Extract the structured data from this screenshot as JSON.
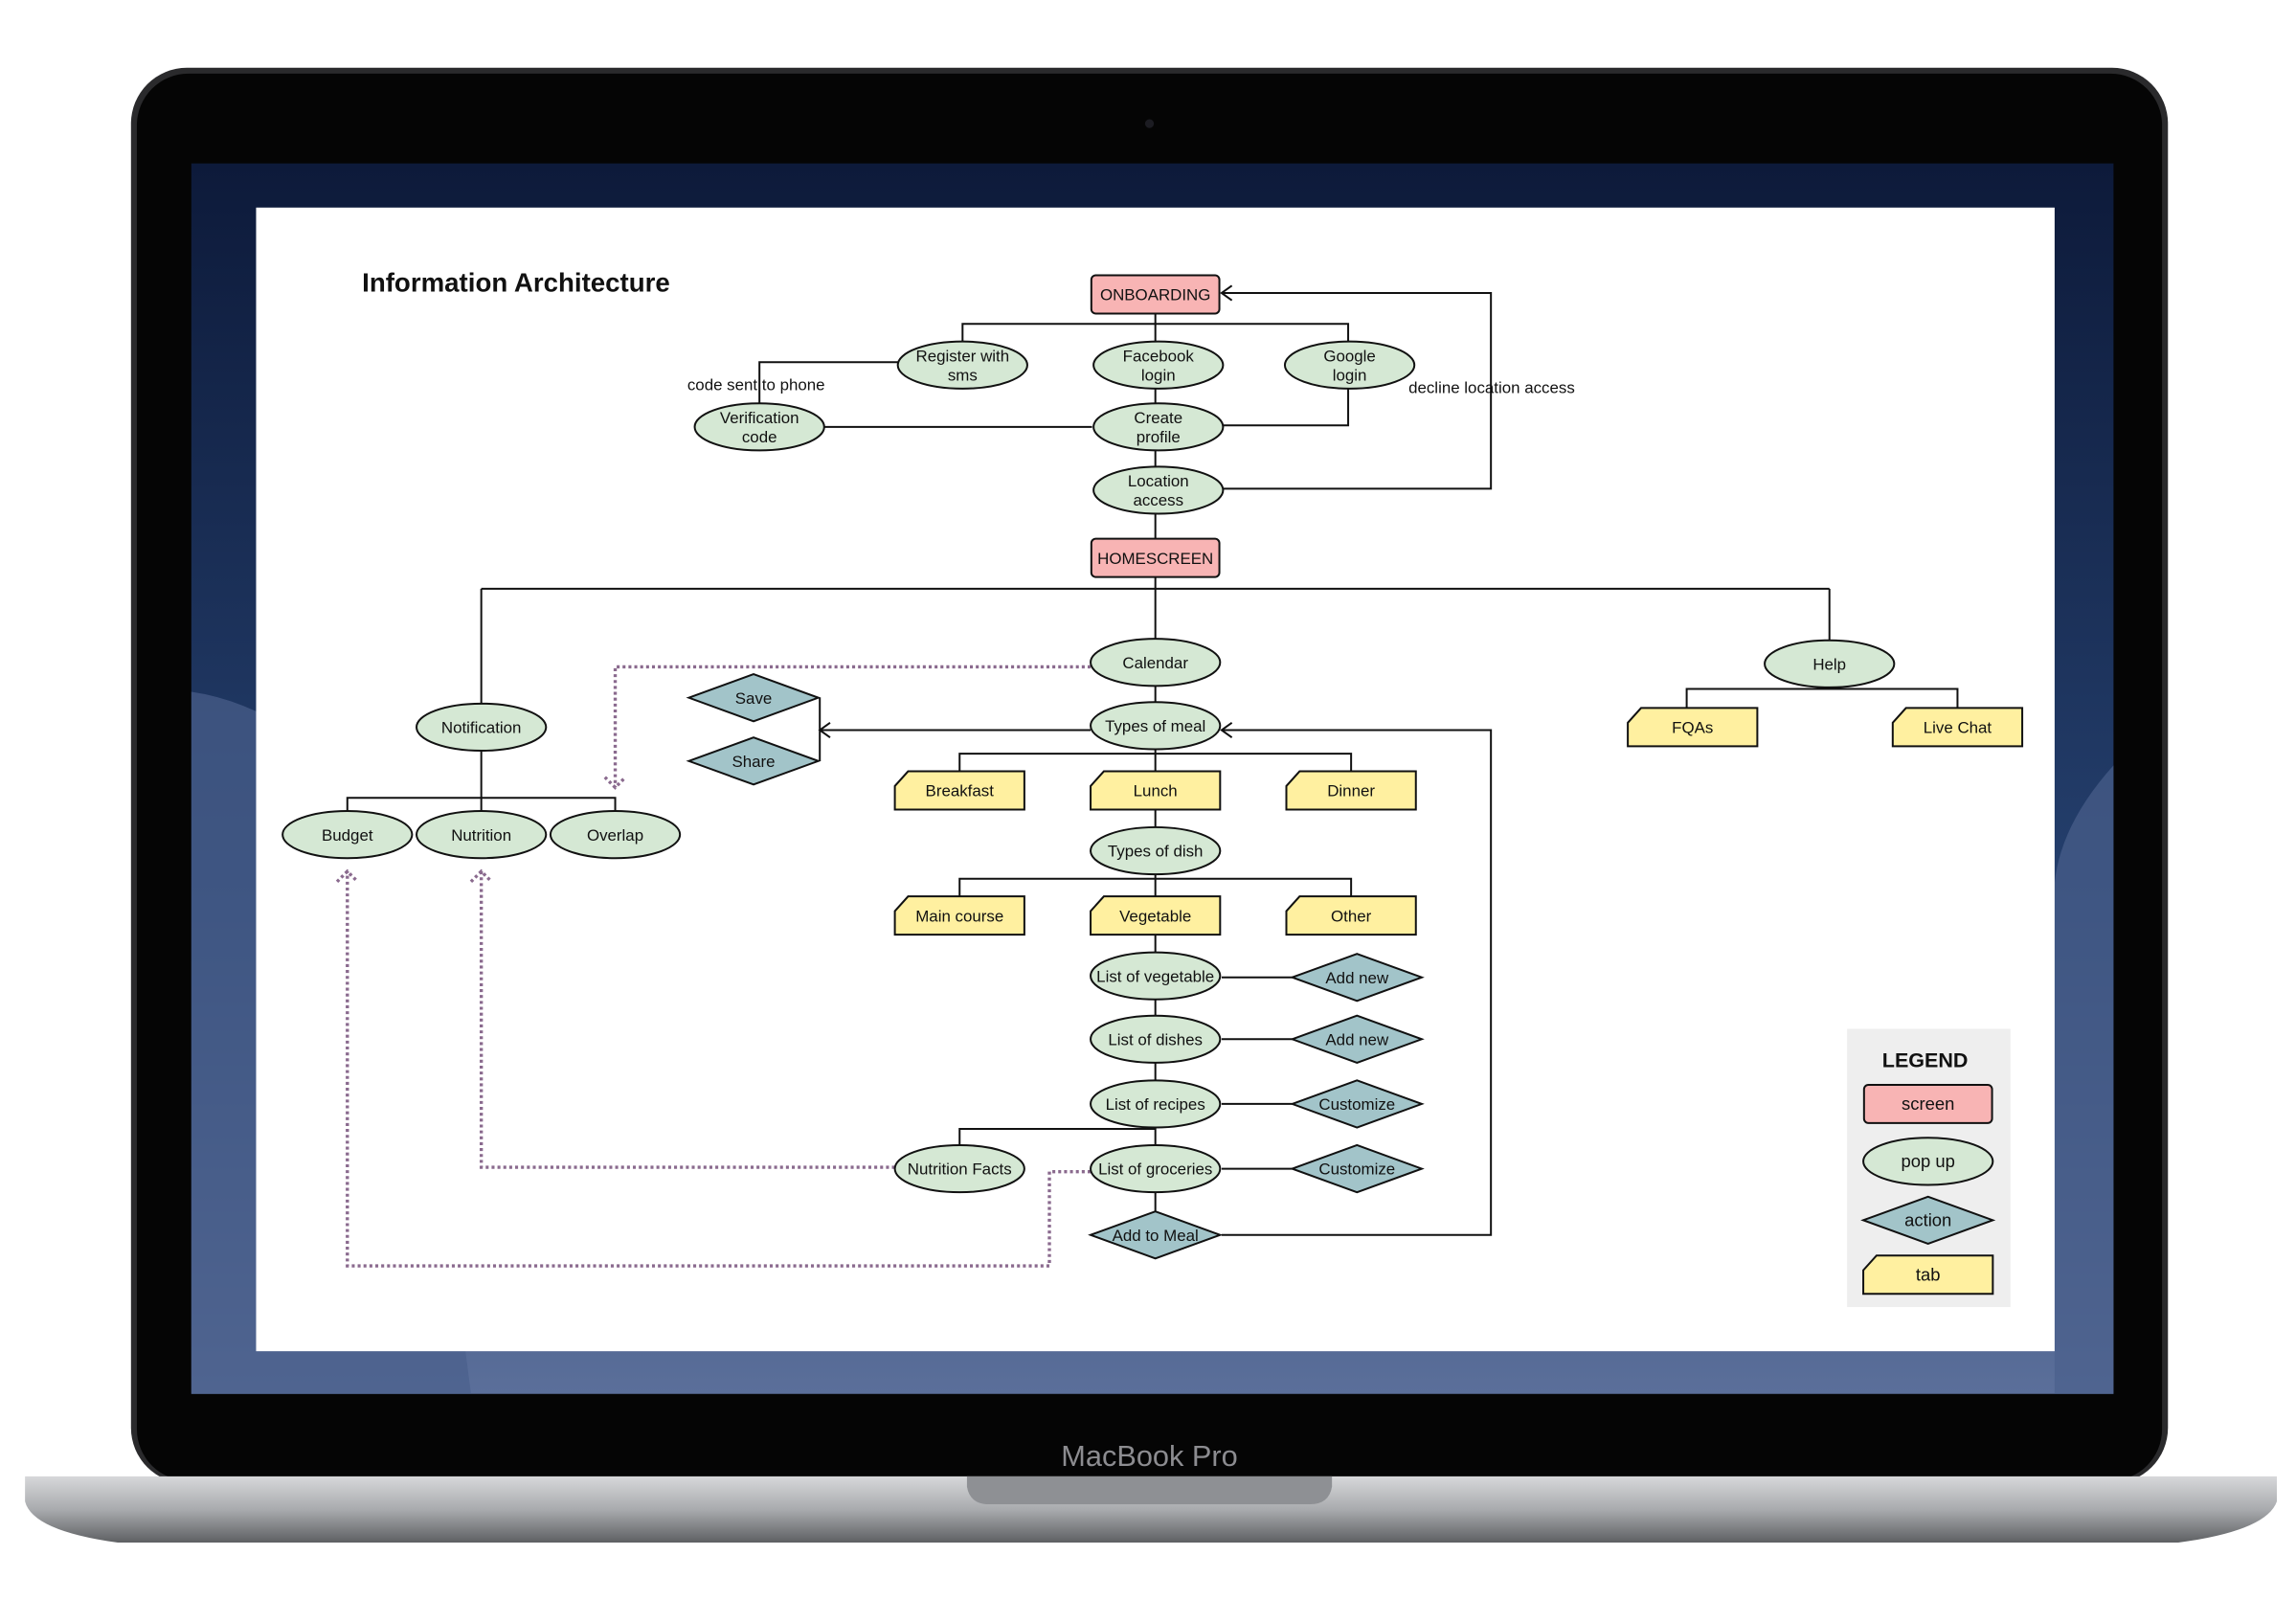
{
  "device": {
    "label": "MacBook Pro"
  },
  "diagram": {
    "title": "Information Architecture",
    "colors": {
      "screen": "#f8b4b4",
      "popup": "#d5e8d4",
      "action": "#a2c4c9",
      "tab": "#fff0a0",
      "dotted": "#8a6a8e"
    },
    "edge_labels": {
      "code_sent": "code sent to phone",
      "decline": "decline location access"
    },
    "nodes": {
      "onboarding": {
        "type": "screen",
        "label": [
          "ONBOARDING"
        ]
      },
      "register": {
        "type": "popup",
        "label": [
          "Register with",
          "sms"
        ]
      },
      "facebook": {
        "type": "popup",
        "label": [
          "Facebook",
          "login"
        ]
      },
      "google": {
        "type": "popup",
        "label": [
          "Google",
          "login"
        ]
      },
      "verification": {
        "type": "popup",
        "label": [
          "Verification",
          "code"
        ]
      },
      "create_profile": {
        "type": "popup",
        "label": [
          "Create",
          "profile"
        ]
      },
      "location": {
        "type": "popup",
        "label": [
          "Location",
          "access"
        ]
      },
      "homescreen": {
        "type": "screen",
        "label": [
          "HOMESCREEN"
        ]
      },
      "notification": {
        "type": "popup",
        "label": [
          "Notification"
        ]
      },
      "budget": {
        "type": "popup",
        "label": [
          "Budget"
        ]
      },
      "nutrition": {
        "type": "popup",
        "label": [
          "Nutrition"
        ]
      },
      "overlap": {
        "type": "popup",
        "label": [
          "Overlap"
        ]
      },
      "calendar": {
        "type": "popup",
        "label": [
          "Calendar"
        ]
      },
      "types_meal": {
        "type": "popup",
        "label": [
          "Types of meal"
        ]
      },
      "save": {
        "type": "action",
        "label": [
          "Save"
        ]
      },
      "share": {
        "type": "action",
        "label": [
          "Share"
        ]
      },
      "breakfast": {
        "type": "tab",
        "label": [
          "Breakfast"
        ]
      },
      "lunch": {
        "type": "tab",
        "label": [
          "Lunch"
        ]
      },
      "dinner": {
        "type": "tab",
        "label": [
          "Dinner"
        ]
      },
      "types_dish": {
        "type": "popup",
        "label": [
          "Types of dish"
        ]
      },
      "main_course": {
        "type": "tab",
        "label": [
          "Main course"
        ]
      },
      "vegetable": {
        "type": "tab",
        "label": [
          "Vegetable"
        ]
      },
      "other": {
        "type": "tab",
        "label": [
          "Other"
        ]
      },
      "list_veg": {
        "type": "popup",
        "label": [
          "List of vegetable"
        ]
      },
      "add_new_1": {
        "type": "action",
        "label": [
          "Add new"
        ]
      },
      "list_dishes": {
        "type": "popup",
        "label": [
          "List of dishes"
        ]
      },
      "add_new_2": {
        "type": "action",
        "label": [
          "Add new"
        ]
      },
      "list_recipes": {
        "type": "popup",
        "label": [
          "List of recipes"
        ]
      },
      "customize_1": {
        "type": "action",
        "label": [
          "Customize"
        ]
      },
      "nutrition_facts": {
        "type": "popup",
        "label": [
          "Nutrition Facts"
        ]
      },
      "list_groceries": {
        "type": "popup",
        "label": [
          "List of groceries"
        ]
      },
      "customize_2": {
        "type": "action",
        "label": [
          "Customize"
        ]
      },
      "add_to_meal": {
        "type": "action",
        "label": [
          "Add to Meal"
        ]
      },
      "help": {
        "type": "popup",
        "label": [
          "Help"
        ]
      },
      "faqs": {
        "type": "tab",
        "label": [
          "FQAs"
        ]
      },
      "live_chat": {
        "type": "tab",
        "label": [
          "Live Chat"
        ]
      }
    },
    "legend": {
      "title": "LEGEND",
      "items": [
        {
          "type": "screen",
          "label": "screen"
        },
        {
          "type": "popup",
          "label": "pop up"
        },
        {
          "type": "action",
          "label": "action"
        },
        {
          "type": "tab",
          "label": "tab"
        }
      ]
    }
  }
}
